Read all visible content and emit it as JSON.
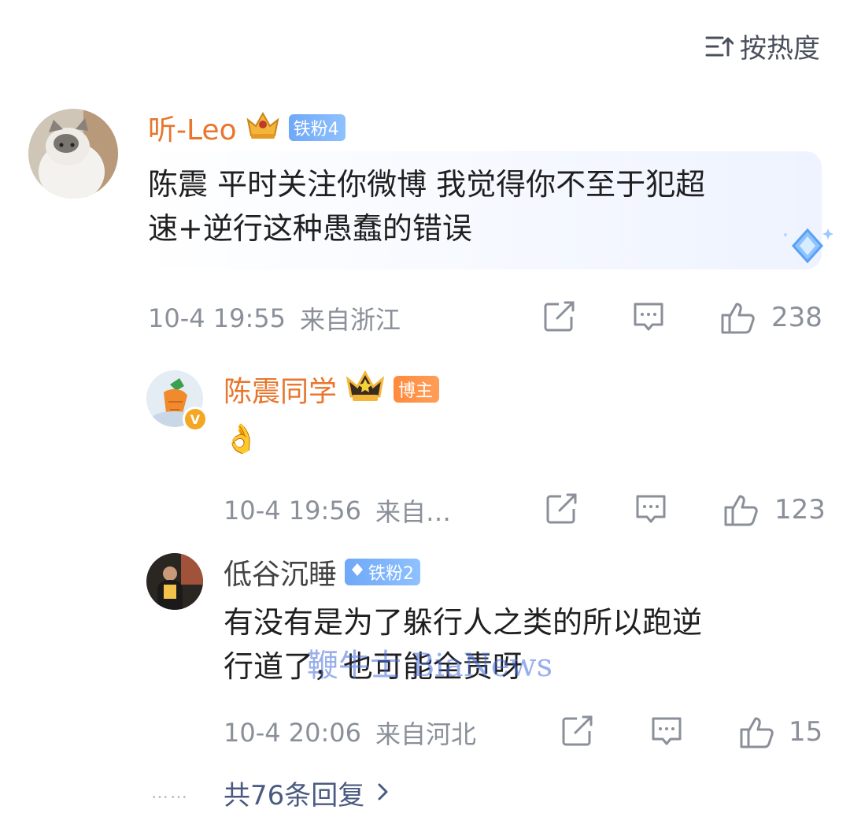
{
  "sort": {
    "label": "按热度"
  },
  "comment": {
    "author": "听-Leo",
    "fan_badge": "铁粉4",
    "text_line1": "陈震 平时关注你微博 我觉得你不至于犯超",
    "text_line2": "速+逆行这种愚蠢的错误",
    "time": "10-4 19:55",
    "location": "来自浙江",
    "likes": "238"
  },
  "reply1": {
    "author": "陈震同学",
    "role_badge": "博主",
    "emoji": "👌",
    "time": "10-4 19:56",
    "location": "来自…",
    "likes": "123"
  },
  "reply2": {
    "author": "低谷沉睡",
    "fan_badge": "铁粉2",
    "text_line1": "有没有是为了躲行人之类的所以跑逆",
    "text_line2": "行道了，也可能全责呀",
    "time": "10-4 20:06",
    "location": "来自河北",
    "likes": "15"
  },
  "more_replies": {
    "dots": "……",
    "label": "共76条回复"
  },
  "watermark": "鞭牛士 BiaNews",
  "colors": {
    "name_orange": "#e8762d",
    "meta_gray": "#8a8f99",
    "link_blue": "#4a5a80"
  },
  "icons": [
    "sort-icon",
    "share-icon",
    "comment-icon",
    "like-icon",
    "verified-icon",
    "crown-icon",
    "diamond-icon",
    "chevron-right-icon"
  ]
}
